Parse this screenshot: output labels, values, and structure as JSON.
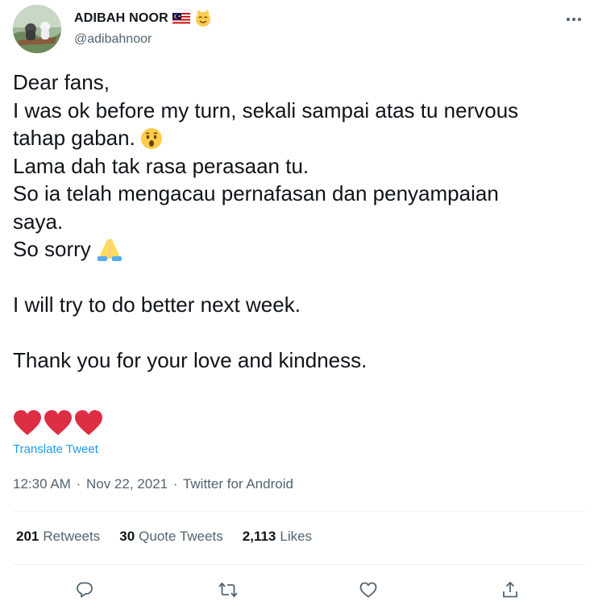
{
  "author": {
    "display_name": "ADIBAH NOOR",
    "handle": "@adibahnoor",
    "avatar_icon": "avatar-photo",
    "badges": [
      "malaysia-flag-icon",
      "smiling-cat-face-icon"
    ]
  },
  "tweet": {
    "lines": [
      "Dear fans,",
      "I was ok before my turn, sekali sampai atas tu nervous",
      "tahap gaban.",
      "Lama dah tak rasa perasaan tu.",
      "So ia telah mengacau pernafasan dan penyampaian",
      "saya.",
      "So sorry",
      "",
      "I will try to do better next week.",
      "",
      "Thank you for your love and kindness.",
      "",
      ""
    ],
    "inline_emojis": {
      "line_3": "astonished-face-icon",
      "line_7": "folded-hands-icon"
    },
    "hearts": [
      "red-heart-icon",
      "red-heart-icon",
      "red-heart-icon"
    ],
    "translate_label": "Translate Tweet"
  },
  "meta": {
    "time": "12:30 AM",
    "separator1": "·",
    "date": "Nov 22, 2021",
    "separator2": "·",
    "source": "Twitter for Android"
  },
  "stats": {
    "retweets_count": "201",
    "retweets_label": "Retweets",
    "quotes_count": "30",
    "quotes_label": "Quote Tweets",
    "likes_count": "2,113",
    "likes_label": "Likes"
  },
  "actions": [
    "reply-icon",
    "retweet-icon",
    "like-icon",
    "share-icon"
  ],
  "colors": {
    "text": "#0f1419",
    "secondary": "#536471",
    "link": "#1d9bf0",
    "heart": "#dd2e44",
    "divider": "#eff3f4"
  }
}
